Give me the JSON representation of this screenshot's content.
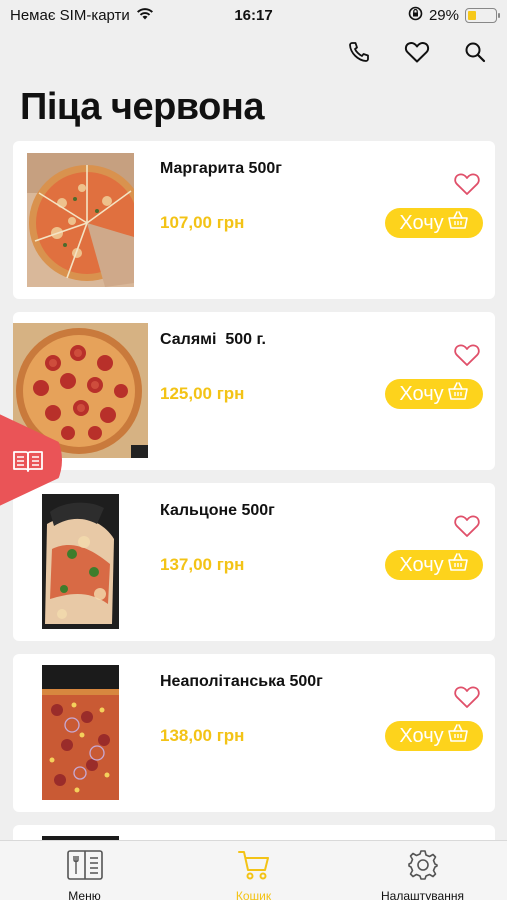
{
  "status_bar": {
    "carrier": "Немає SIM-карти",
    "time": "16:17",
    "battery_percent": "29%",
    "battery_level": 0.29
  },
  "header": {
    "icons": [
      "phone-icon",
      "heart-icon",
      "search-icon"
    ]
  },
  "page": {
    "title": "Піца червона"
  },
  "products": [
    {
      "name": "Маргарита 500г",
      "price": "107,00 грн",
      "button_label": "Хочу",
      "favorite": false
    },
    {
      "name": "Салямі  500 г.",
      "price": "125,00 грн",
      "button_label": "Хочу",
      "favorite": false
    },
    {
      "name": "Кальцоне 500г",
      "price": "137,00 грн",
      "button_label": "Хочу",
      "favorite": false
    },
    {
      "name": "Неаполітанська 500г",
      "price": "138,00 грн",
      "button_label": "Хочу",
      "favorite": false
    }
  ],
  "tabbar": {
    "items": [
      {
        "label": "Меню",
        "icon": "menu-book-icon",
        "active": false
      },
      {
        "label": "Кошик",
        "icon": "cart-icon",
        "active": true
      },
      {
        "label": "Налаштування",
        "icon": "gear-icon",
        "active": false
      }
    ]
  },
  "colors": {
    "accent": "#fdd31c",
    "price": "#f3c316",
    "heart": "#e0506a",
    "side_tab": "#ea5457"
  }
}
